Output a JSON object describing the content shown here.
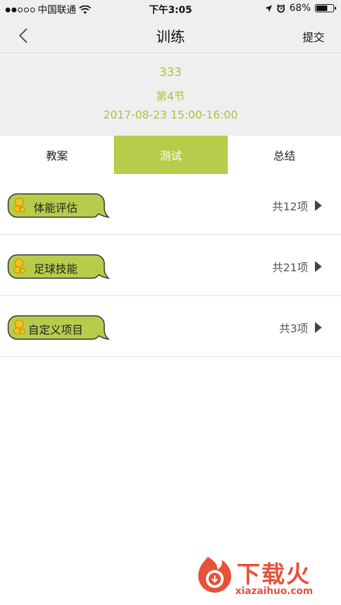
{
  "status_bar": {
    "carrier": "中国联通",
    "time": "下午3:05",
    "battery": "68%",
    "battery_level": 0.68
  },
  "nav": {
    "back_icon": "chevron-left-icon",
    "title": "训练",
    "submit_label": "提交"
  },
  "session": {
    "name": "333",
    "lesson": "第4节",
    "time": "2017-08-23 15:00-16:00"
  },
  "tabs": [
    {
      "label": "教案",
      "active": false
    },
    {
      "label": "测试",
      "active": true
    },
    {
      "label": "总结",
      "active": false
    }
  ],
  "items": [
    {
      "label": "体能评估",
      "count": "共12项"
    },
    {
      "label": "足球技能",
      "count": "共21项"
    },
    {
      "label": "自定义项目",
      "count": "共3项"
    }
  ],
  "watermark": {
    "title": "下载火",
    "domain": "xiazaihuo.com"
  },
  "colors": {
    "accent": "#b8cc4c",
    "header_text": "#a9c23a",
    "bubble_fill": "#b8cc4c",
    "bubble_dot": "#f4c21a",
    "watermark": "#e7513a"
  }
}
